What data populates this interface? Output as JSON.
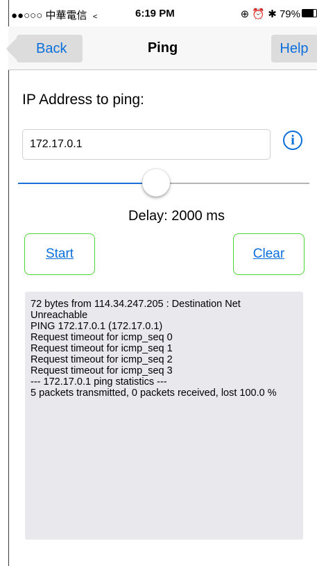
{
  "status_bar": {
    "carrier": "●●○○○ 中華電信",
    "wifi_icon": "wifi-icon",
    "time": "6:19 PM",
    "right_icons": "⊕ ⏰ ✱",
    "battery_percent": "79%",
    "battery_level": 0.79
  },
  "nav": {
    "back_label": "Back",
    "title": "Ping",
    "help_label": "Help"
  },
  "form": {
    "ip_label": "IP Address to ping:",
    "ip_value": "172.17.0.1",
    "info_icon": "i",
    "delay_text": "Delay: 2000 ms",
    "slider_fraction": 0.45,
    "start_label": "Start",
    "clear_label": "Clear"
  },
  "output": {
    "lines": [
      "72 bytes from 114.34.247.205 : Destination Net Unreachable",
      "PING 172.17.0.1 (172.17.0.1)",
      "Request timeout for icmp_seq 0",
      "Request timeout for icmp_seq 1",
      "Request timeout for icmp_seq 2",
      "Request timeout for icmp_seq 3",
      "--- 172.17.0.1 ping statistics ---",
      "5 packets transmitted, 0 packets received, lost 100.0 %"
    ]
  },
  "colors": {
    "accent": "#0a6edb",
    "button_border": "#4cd436",
    "output_bg": "#e8e8ed"
  }
}
